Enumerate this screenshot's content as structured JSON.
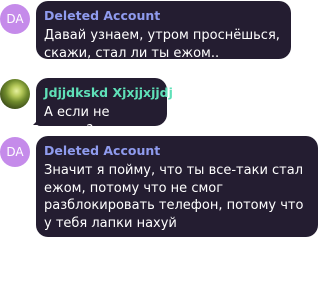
{
  "colors": {
    "bubble_bg": "#241d31",
    "deleted_name": "#8f9bee",
    "user_name": "#5fe0b8",
    "avatar_initials_bg": "#c58bea"
  },
  "messages": [
    {
      "avatar_text": "DA",
      "name": "Deleted Account",
      "text": "Давай узнаем, утром проснёшься, скажи, стал ли ты ежом.."
    },
    {
      "avatar_icon": "user-photo-avatar",
      "name": "Jdjjdkskd Xjxjjxjjdj",
      "text": "А если не скажу?"
    },
    {
      "avatar_text": "DA",
      "name": "Deleted Account",
      "text": "Значит я пойму, что ты все-таки стал ежом, потому что не смог разблокировать телефон, потому что у тебя лапки нахуй"
    }
  ]
}
